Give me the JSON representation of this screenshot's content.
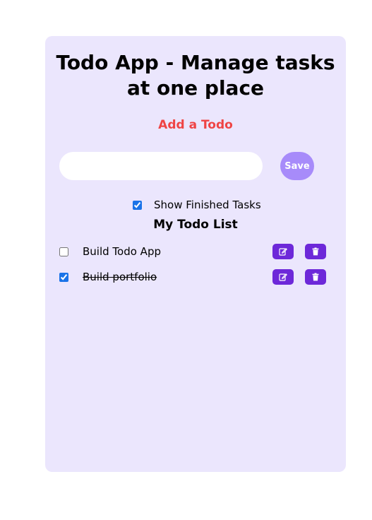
{
  "app": {
    "title": "Todo App - Manage tasks at one place",
    "add_heading": "Add a Todo",
    "input_value": "",
    "save_label": "Save",
    "show_finished_label": "Show Finished Tasks",
    "show_finished_checked": true,
    "list_heading": "My Todo List"
  },
  "todos": [
    {
      "text": "Build Todo App",
      "done": false,
      "edit_icon": "edit-icon",
      "delete_icon": "trash-icon"
    },
    {
      "text": "Build portfolio",
      "done": true,
      "edit_icon": "edit-icon",
      "delete_icon": "trash-icon"
    }
  ],
  "colors": {
    "card_bg": "#ebe6fd",
    "accent": "#6d28d9",
    "save_button": "#a78bfa",
    "heading_accent": "#ef4444"
  }
}
